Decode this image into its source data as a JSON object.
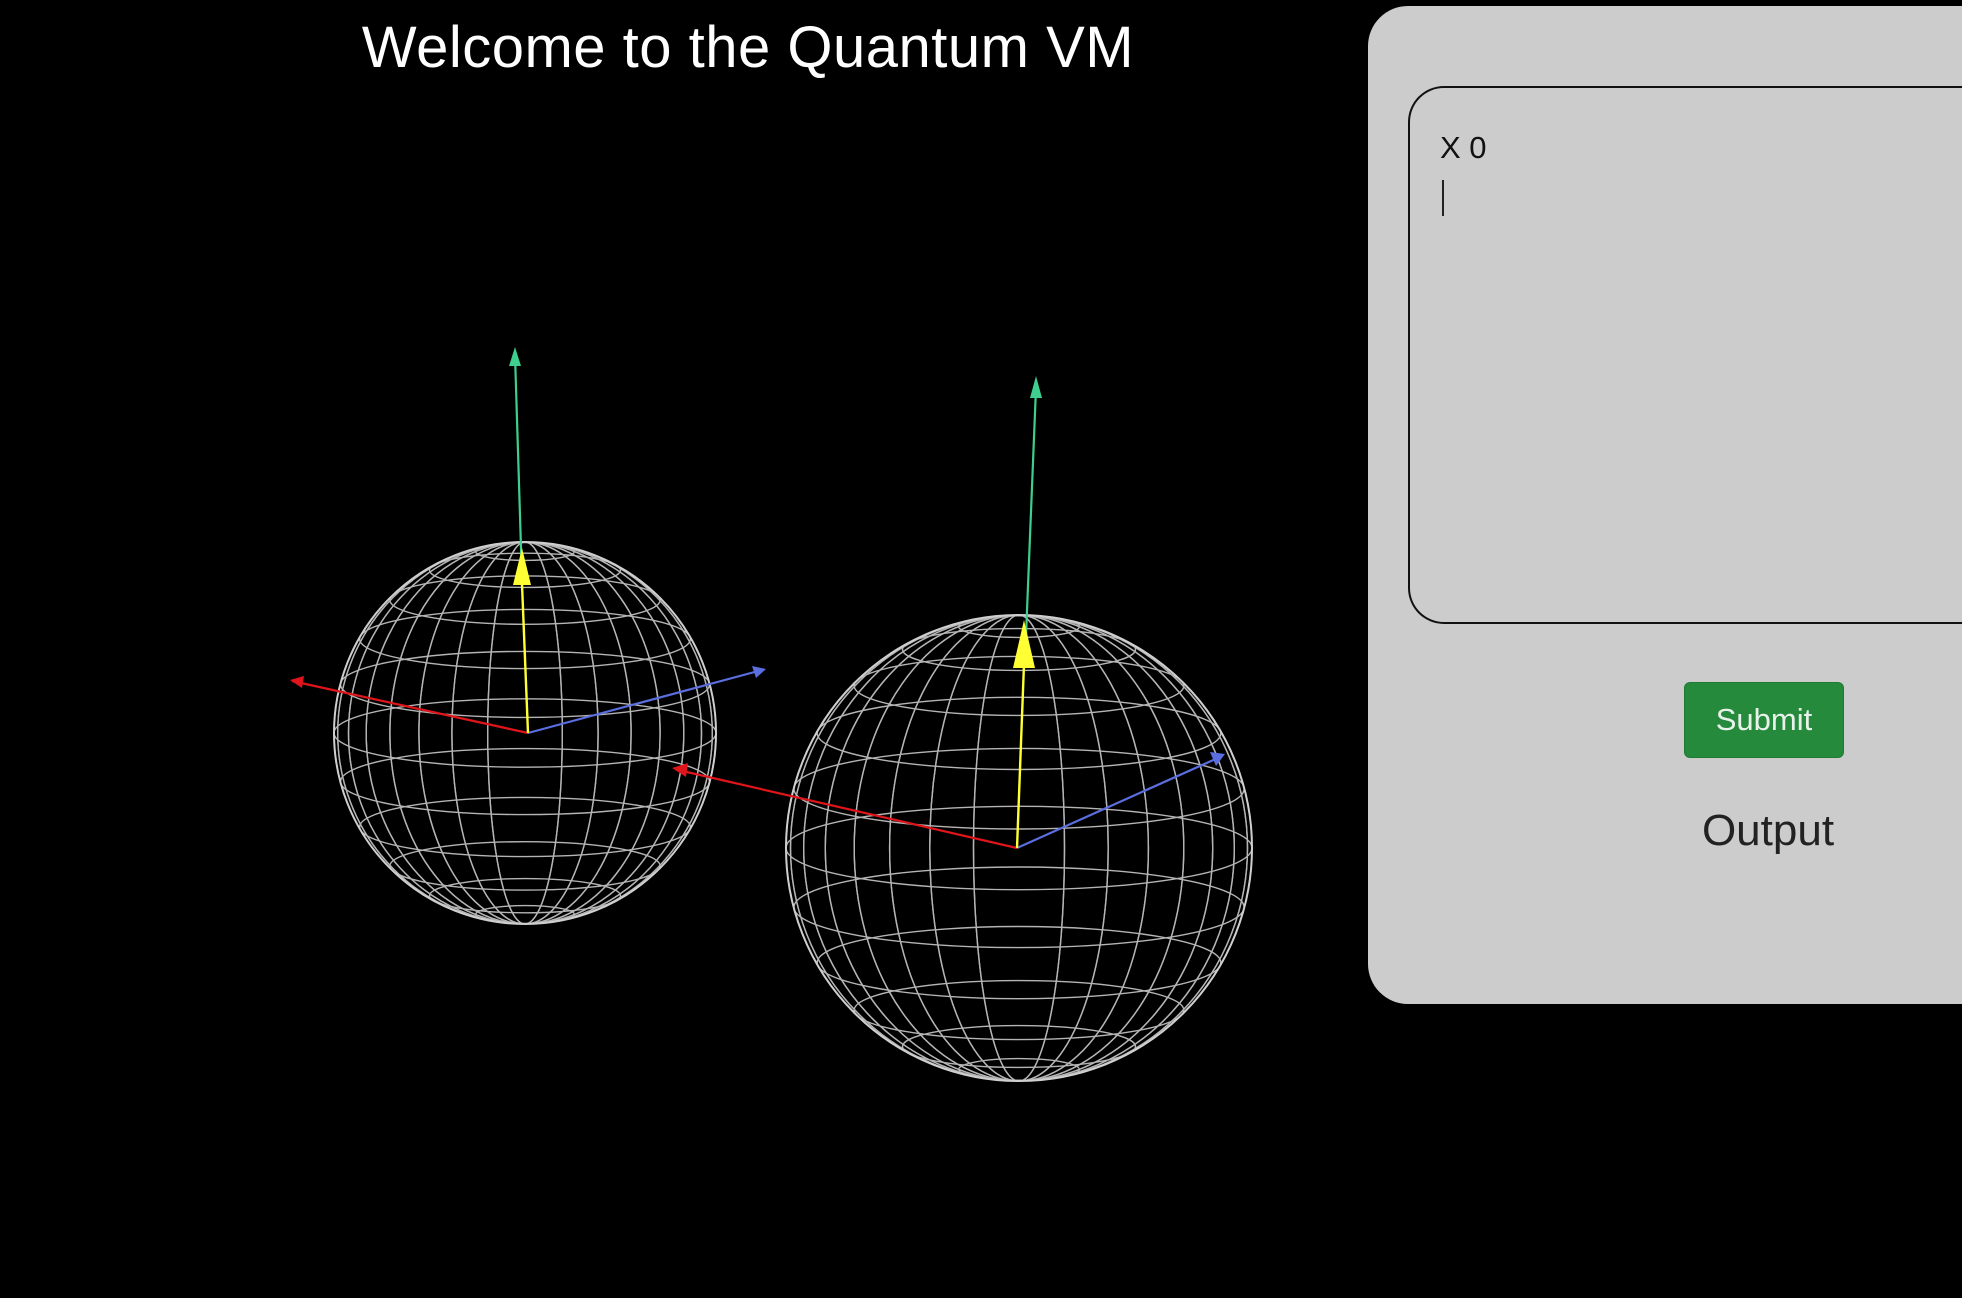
{
  "page": {
    "title": "Welcome to the Quantum VM"
  },
  "editor": {
    "code": "X 0"
  },
  "controls": {
    "submit_label": "Submit",
    "output_heading": "Output"
  },
  "colors": {
    "background": "#000000",
    "panel": "#cccccc",
    "submit": "#258a3c",
    "x_axis": "#e0151b",
    "y_axis": "#3ecf8e",
    "z_axis": "#5b6ee0",
    "state_vector": "#ffff33",
    "wireframe": "#c8c8c8"
  },
  "icons": {
    "scene": "bloch-sphere-icon"
  }
}
